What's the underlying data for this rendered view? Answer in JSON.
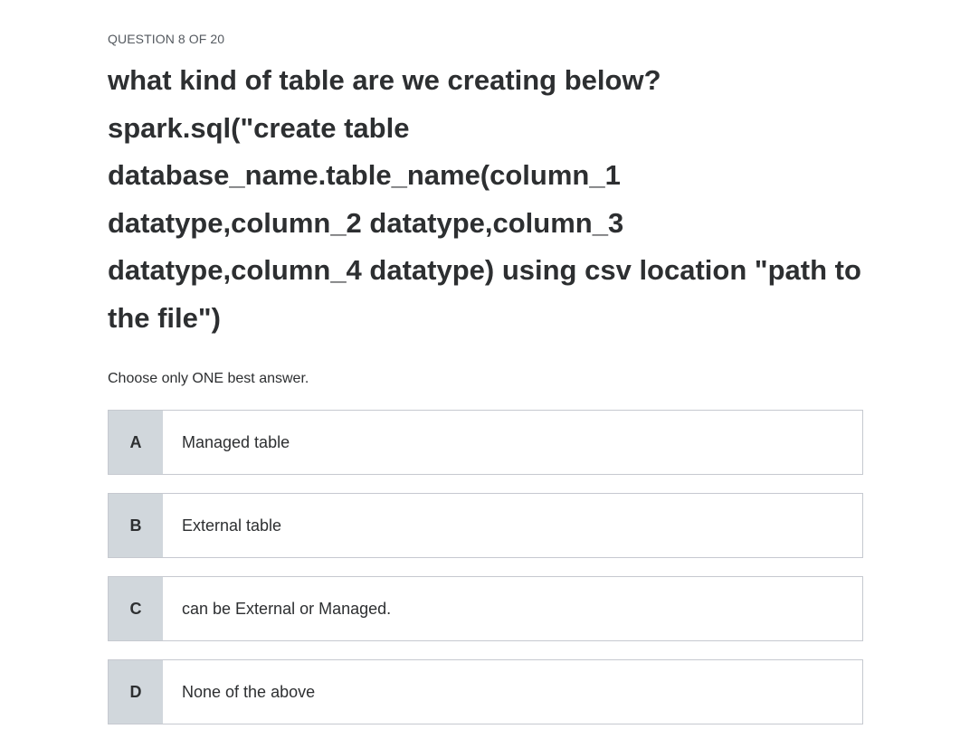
{
  "quiz": {
    "counter": "QUESTION 8 OF 20",
    "question": "what kind of table are we creating below? spark.sql(\"create table database_name.table_name(column_1 datatype,column_2 datatype,column_3 datatype,column_4 datatype) using csv location \"path to the file\")",
    "instruction": "Choose only ONE best answer.",
    "options": [
      {
        "letter": "A",
        "text": "Managed table"
      },
      {
        "letter": "B",
        "text": "External table"
      },
      {
        "letter": "C",
        "text": "can be External or Managed."
      },
      {
        "letter": "D",
        "text": "None of the above"
      }
    ]
  },
  "colors": {
    "letter_bg": "#d1d7dc",
    "border": "#c6c9d0",
    "text": "#2d2f31"
  }
}
